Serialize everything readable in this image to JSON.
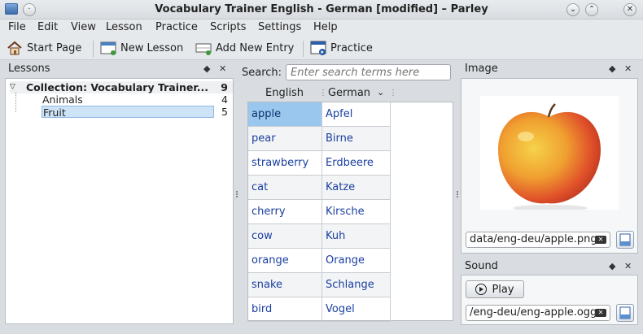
{
  "window": {
    "title": "Vocabulary Trainer English - German [modified] – Parley",
    "min_glyph": "⌄",
    "max_glyph": "⌃",
    "close_glyph": "✕",
    "menu_glyph": "·"
  },
  "menu": [
    "File",
    "Edit",
    "View",
    "Lesson",
    "Practice",
    "Scripts",
    "Settings",
    "Help"
  ],
  "toolbar": {
    "start_page": "Start Page",
    "new_lesson": "New Lesson",
    "add_new_entry": "Add New Entry",
    "practice": "Practice"
  },
  "lessons_dock": {
    "title": "Lessons",
    "float_glyph": "◆",
    "close_glyph": "✕",
    "collection": {
      "label": "Collection: Vocabulary Trainer...",
      "count": "9"
    },
    "items": [
      {
        "label": "Animals",
        "count": "4"
      },
      {
        "label": "Fruit",
        "count": "5"
      }
    ]
  },
  "search": {
    "label": "Search:",
    "placeholder": "Enter search terms here"
  },
  "table": {
    "columns": [
      "English",
      "German"
    ],
    "rows": [
      {
        "english": "apple",
        "german": "Apfel"
      },
      {
        "english": "pear",
        "german": "Birne"
      },
      {
        "english": "strawberry",
        "german": "Erdbeere"
      },
      {
        "english": "cat",
        "german": "Katze"
      },
      {
        "english": "cherry",
        "german": "Kirsche"
      },
      {
        "english": "cow",
        "german": "Kuh"
      },
      {
        "english": "orange",
        "german": "Orange"
      },
      {
        "english": "snake",
        "german": "Schlange"
      },
      {
        "english": "bird",
        "german": "Vogel"
      }
    ]
  },
  "image_dock": {
    "title": "Image",
    "float_glyph": "◆",
    "close_glyph": "✕",
    "path": "data/eng-deu/apple.png"
  },
  "sound_dock": {
    "title": "Sound",
    "float_glyph": "◆",
    "close_glyph": "✕",
    "play_label": "Play",
    "path": "/eng-deu/eng-apple.ogg"
  }
}
